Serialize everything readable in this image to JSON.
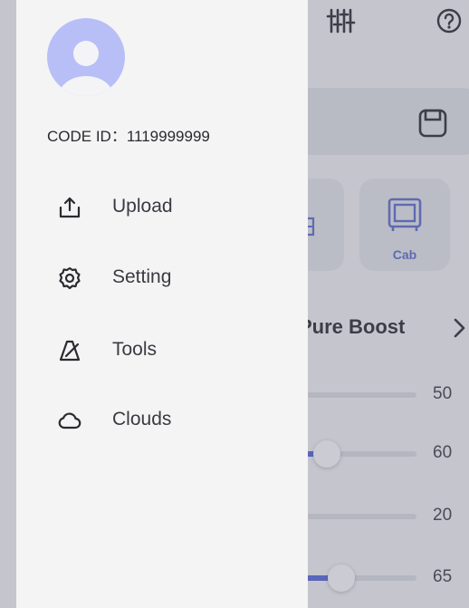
{
  "drawer": {
    "code_id": "CODE ID：1119999999",
    "menu": [
      {
        "label": "Upload",
        "icon": "upload-icon"
      },
      {
        "label": "Setting",
        "icon": "gear-icon"
      },
      {
        "label": "Tools",
        "icon": "metronome-icon"
      },
      {
        "label": "Clouds",
        "icon": "cloud-icon"
      }
    ]
  },
  "background_app": {
    "modules": [
      {
        "label": "Cab",
        "icon": "cabinet-icon"
      }
    ],
    "effect_title": "Pure Boost",
    "sliders": [
      {
        "value_label": "50",
        "value": 50
      },
      {
        "value_label": "60",
        "value": 60
      },
      {
        "value_label": "20",
        "value": 20
      },
      {
        "value_label": "65",
        "value": 65
      }
    ]
  },
  "colors": {
    "accent": "#4a5bd0",
    "avatar_bg": "#b8bff7",
    "drawer_bg": "#f4f4f5"
  }
}
